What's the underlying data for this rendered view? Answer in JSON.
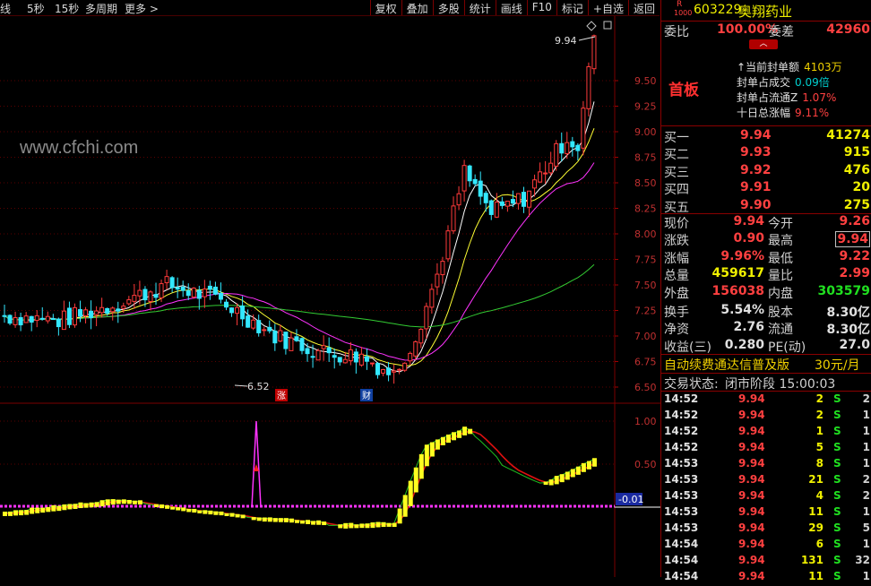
{
  "toolbar": {
    "left": [
      "线",
      "5秒",
      "15秒",
      "多周期",
      "更多 >"
    ],
    "right": [
      "复权",
      "叠加",
      "多股",
      "统计",
      "画线",
      "F10",
      "标记",
      "+自选",
      "返回"
    ]
  },
  "watermark": "www.cfchi.com",
  "chart": {
    "price_labels": [
      "9.50",
      "9.25",
      "9.00",
      "8.75",
      "8.50",
      "8.25",
      "8.00",
      "7.75",
      "7.50",
      "7.25",
      "7.00",
      "6.75",
      "6.50"
    ],
    "high_marker": "9.94",
    "low_marker": "6.52",
    "event_zhang": "涨",
    "event_cai": "财",
    "ind_labels": [
      "1.00",
      "0.50"
    ],
    "ind_current": "-0.01",
    "colors": {
      "up": "#ff3b3b",
      "down": "#33e8ff",
      "ma5": "#ffffff",
      "ma10": "#ffff33",
      "ma20": "#ff33ff",
      "ma60": "#33cc33"
    }
  },
  "quote": {
    "code": "603229",
    "name": "奥翔药业",
    "badge_r": "R",
    "badge_num": "1000",
    "weibi_label": "委比",
    "weibi_value": "100.00%",
    "weicha_label": "委差",
    "weicha_value": "42960",
    "board": "首板",
    "seal_lines": [
      {
        "label": "当前封单额",
        "value": "4103万",
        "prefix": "↑"
      },
      {
        "label": "封单占成交",
        "value": "0.09倍",
        "prefix": ""
      },
      {
        "label": "封单占流通Z",
        "value": "1.07%",
        "prefix": ""
      },
      {
        "label": "十日总涨幅",
        "value": "9.11%",
        "prefix": ""
      }
    ],
    "bids": [
      {
        "label": "买一",
        "price": "9.94",
        "vol": "41274"
      },
      {
        "label": "买二",
        "price": "9.93",
        "vol": "915"
      },
      {
        "label": "买三",
        "price": "9.92",
        "vol": "476"
      },
      {
        "label": "买四",
        "price": "9.91",
        "vol": "20"
      },
      {
        "label": "买五",
        "price": "9.90",
        "vol": "275"
      }
    ],
    "stats": {
      "xianjia": "现价",
      "xianjia_v": "9.94",
      "jinkai": "今开",
      "jinkai_v": "9.26",
      "zhangdie": "涨跌",
      "zhangdie_v": "0.90",
      "zuigao": "最高",
      "zuigao_v": "9.94",
      "zhangfu": "涨幅",
      "zhangfu_v": "9.96%",
      "zuidi": "最低",
      "zuidi_v": "9.22",
      "zongliang": "总量",
      "zongliang_v": "459617",
      "liangbi": "量比",
      "liangbi_v": "2.99",
      "waipan": "外盘",
      "waipan_v": "156038",
      "neipan": "内盘",
      "neipan_v": "303579",
      "huanshou": "换手",
      "huanshou_v": "5.54%",
      "guben": "股本",
      "guben_v": "8.30亿",
      "jingzi": "净资",
      "jingzi_v": "2.76",
      "liutong": "流通",
      "liutong_v": "8.30亿",
      "shouyi": "收益(三)",
      "shouyi_v": "0.280",
      "pe": "PE(动)",
      "pe_v": "27.0"
    },
    "promo_text": "自动续费通达信普及版",
    "promo_price": "30元/月",
    "status_label": "交易状态:",
    "status_value": "闭市阶段 15:00:03"
  },
  "ticks": [
    {
      "time": "14:52",
      "price": "9.94",
      "vol": "2",
      "side": "S",
      "n": "2"
    },
    {
      "time": "14:52",
      "price": "9.94",
      "vol": "2",
      "side": "S",
      "n": "1"
    },
    {
      "time": "14:52",
      "price": "9.94",
      "vol": "1",
      "side": "S",
      "n": "1"
    },
    {
      "time": "14:52",
      "price": "9.94",
      "vol": "5",
      "side": "S",
      "n": "1"
    },
    {
      "time": "14:53",
      "price": "9.94",
      "vol": "8",
      "side": "S",
      "n": "1"
    },
    {
      "time": "14:53",
      "price": "9.94",
      "vol": "21",
      "side": "S",
      "n": "2"
    },
    {
      "time": "14:53",
      "price": "9.94",
      "vol": "4",
      "side": "S",
      "n": "2"
    },
    {
      "time": "14:53",
      "price": "9.94",
      "vol": "11",
      "side": "S",
      "n": "1"
    },
    {
      "time": "14:53",
      "price": "9.94",
      "vol": "29",
      "side": "S",
      "n": "5"
    },
    {
      "time": "14:54",
      "price": "9.94",
      "vol": "6",
      "side": "S",
      "n": "1"
    },
    {
      "time": "14:54",
      "price": "9.94",
      "vol": "131",
      "side": "S",
      "n": "32"
    },
    {
      "time": "14:54",
      "price": "9.94",
      "vol": "11",
      "side": "S",
      "n": "1"
    }
  ]
}
